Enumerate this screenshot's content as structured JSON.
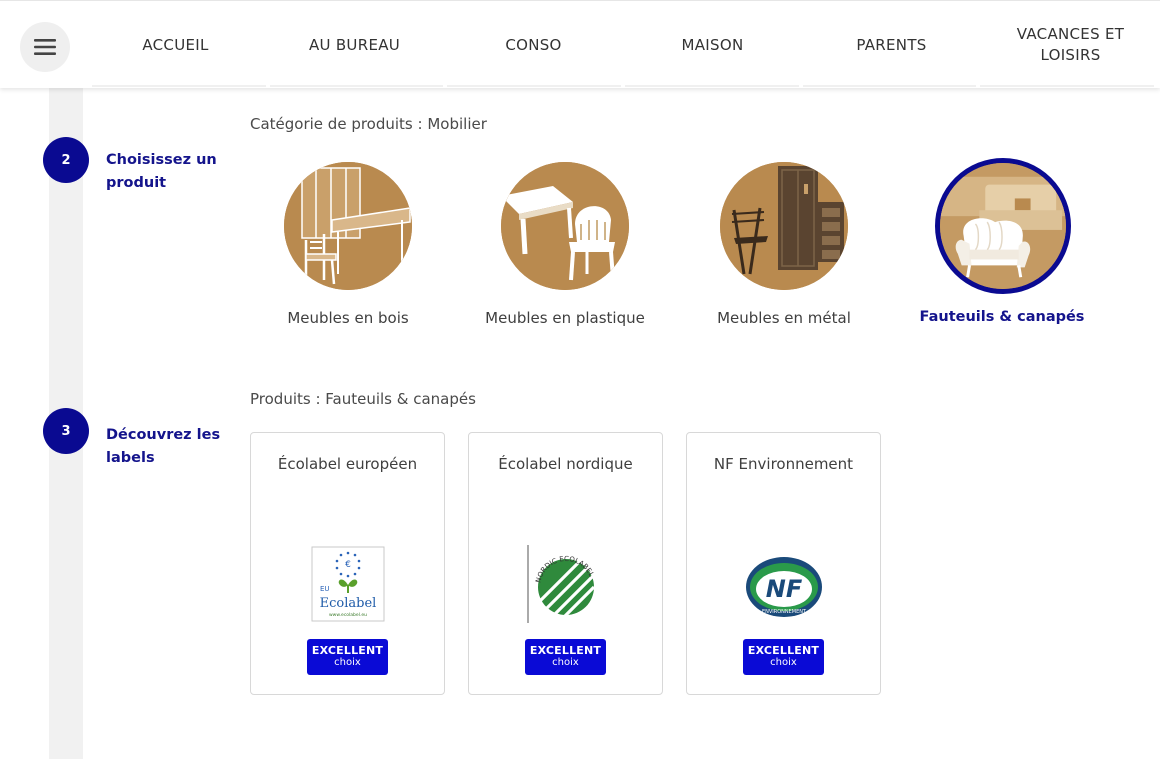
{
  "header": {
    "nav": [
      "Accueil",
      "Au bureau",
      "Conso",
      "Maison",
      "Parents",
      "Vacances et loisirs"
    ]
  },
  "steps": [
    {
      "number": "2",
      "title": "Choisissez un produit"
    },
    {
      "number": "3",
      "title": "Découvrez les labels"
    }
  ],
  "categories_section": {
    "label": "Catégorie de produits : Mobilier",
    "items": [
      {
        "label": "Meubles en bois",
        "icon": "wood-furniture-icon"
      },
      {
        "label": "Meubles en plastique",
        "icon": "plastic-furniture-icon"
      },
      {
        "label": "Meubles en métal",
        "icon": "metal-furniture-icon"
      },
      {
        "label": "Fauteuils & canapés",
        "icon": "armchair-sofa-icon",
        "selected": true
      }
    ]
  },
  "products_section": {
    "label": "Produits : Fauteuils & canapés",
    "cards": [
      {
        "title": "Écolabel européen",
        "logo": "eu-ecolabel-logo",
        "logo_text": "Ecolabel",
        "logo_small": "www.ecolabel.eu",
        "badge_top": "EXCELLENT",
        "badge_bottom": "choix"
      },
      {
        "title": "Écolabel nordique",
        "logo": "nordic-ecolabel-logo",
        "logo_text": "NORDIC ECOLABEL",
        "badge_top": "EXCELLENT",
        "badge_bottom": "choix"
      },
      {
        "title": "NF Environnement",
        "logo": "nf-environnement-logo",
        "logo_text": "NF",
        "logo_small": "ENVIRONNEMENT",
        "badge_top": "EXCELLENT",
        "badge_bottom": "choix"
      }
    ]
  },
  "colors": {
    "accent": "#0a0a91",
    "badge": "#0a0ad6",
    "category_circle": "#b98a4f"
  }
}
